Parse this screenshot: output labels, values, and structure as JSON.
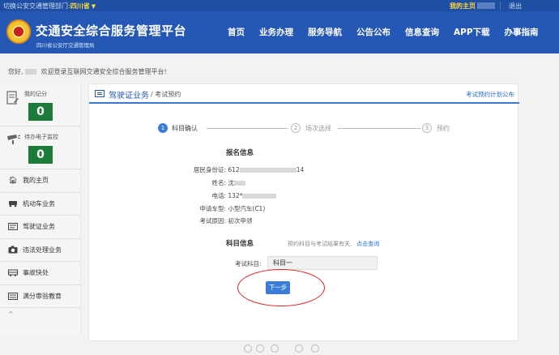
{
  "topbar": {
    "switch_label": "切换公安交通管理部门:",
    "province": "四川省",
    "caret": "▼",
    "my_home": "我的主页",
    "logout": "退出"
  },
  "header": {
    "title": "交通安全综合服务管理平台",
    "subtitle": "四川省公安厅交通管理局",
    "nav": [
      "首页",
      "业务办理",
      "服务导航",
      "公告公布",
      "信息查询",
      "APP下载",
      "办事指南"
    ]
  },
  "welcome": {
    "prefix": "您好,",
    "message": "欢迎登录互联网交通安全综合服务管理平台!"
  },
  "sidebar": {
    "score": {
      "label": "我的记分",
      "count": "0"
    },
    "monitor": {
      "label": "待办电子监控",
      "count": "0"
    },
    "items": [
      {
        "label": "我的主页",
        "icon": "home-icon"
      },
      {
        "label": "机动车业务",
        "icon": "car-icon"
      },
      {
        "label": "驾驶证业务",
        "icon": "license-icon"
      },
      {
        "label": "违法处理业务",
        "icon": "camera-icon"
      },
      {
        "label": "事故快处",
        "icon": "accident-icon"
      },
      {
        "label": "满分审验教育",
        "icon": "education-icon"
      }
    ],
    "more": "^"
  },
  "panel": {
    "title": "驾驶证业务",
    "crumb": "/ 考试预约",
    "plan_link": "考试预约计划公布",
    "steps": [
      {
        "num": "1",
        "label": "科目确认",
        "active": true
      },
      {
        "num": "2",
        "label": "场次选择",
        "active": false
      },
      {
        "num": "3",
        "label": "预约",
        "active": false
      }
    ]
  },
  "registration": {
    "title": "报名信息",
    "fields": [
      {
        "key": "居民身份证:",
        "prefix": "612",
        "suffix": "14"
      },
      {
        "key": "姓名:",
        "prefix": "沈",
        "suffix": ""
      },
      {
        "key": "电话:",
        "prefix": "132*",
        "suffix": ""
      },
      {
        "key": "申请车型:",
        "prefix": "小型汽车(C1)",
        "suffix": ""
      },
      {
        "key": "考试原因:",
        "prefix": "初次申领",
        "suffix": ""
      }
    ]
  },
  "subject": {
    "title": "科目信息",
    "hint": "预约科目与考试结果有关,",
    "hint_link": "点击查询",
    "label": "考试科目:",
    "value": "科目一",
    "next": "下一步"
  },
  "colors": {
    "topbar": "#1f4fa3",
    "header": "#2558b4",
    "accent": "#3a7dd8",
    "count_badge": "#1d7b3a",
    "annotation": "#d82020"
  }
}
